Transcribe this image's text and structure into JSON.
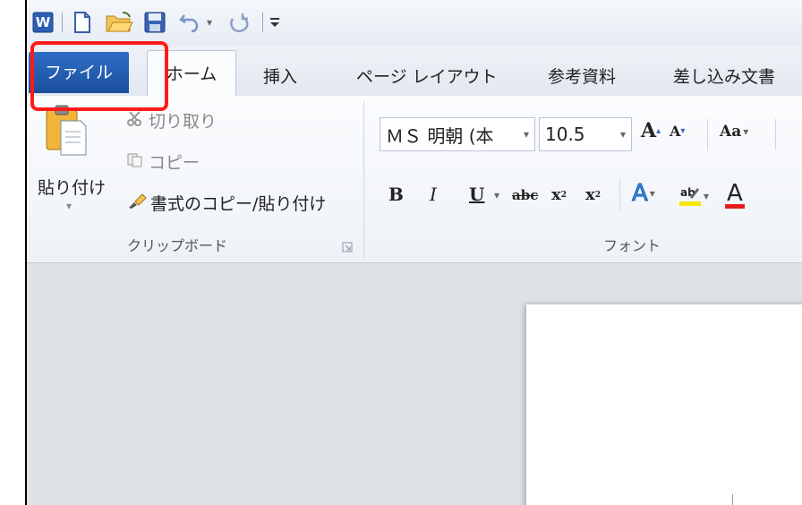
{
  "quick_access": {
    "items": [
      "word-logo",
      "new-document-icon",
      "open-folder-icon",
      "save-icon",
      "undo-icon",
      "redo-icon",
      "customize-icon"
    ],
    "undo_dropdown": "▾",
    "redo_dropdown": "▾"
  },
  "tabs": {
    "file": "ファイル",
    "home": "ホーム",
    "insert": "挿入",
    "page_layout": "ページ レイアウト",
    "references": "参考資料",
    "mailings": "差し込み文書"
  },
  "clipboard": {
    "paste_label": "貼り付け",
    "cut_label": "切り取り",
    "copy_label": "コピー",
    "format_painter_label": "書式のコピー/貼り付け",
    "group_label": "クリップボード"
  },
  "font": {
    "font_name": "ＭＳ 明朝 (本",
    "font_size": "10.5",
    "group_label": "フォント",
    "buttons": [
      "bold",
      "italic",
      "underline",
      "strikethrough",
      "subscript",
      "superscript",
      "text-effects",
      "highlight",
      "font-color"
    ]
  },
  "colors": {
    "file_tab": "#1b4f9c",
    "highlight_box": "#ff1a1a",
    "ribbon_bg": "#f7f9fc",
    "workspace_bg": "#dfe3e8"
  }
}
